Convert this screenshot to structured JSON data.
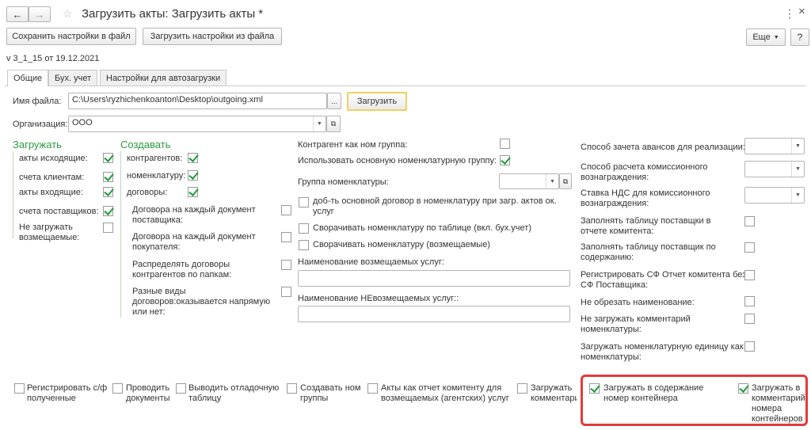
{
  "window": {
    "title": "Загрузить акты: Загрузить акты *"
  },
  "toolbar": {
    "save_settings": "Сохранить настройки в файл",
    "load_settings": "Загрузить настройки из файла",
    "more": "Еще",
    "help": "?"
  },
  "version": "v 3_1_15 от 19.12.2021",
  "tabs": [
    "Общие",
    "Бух. учет",
    "Настройки для автозагрузки"
  ],
  "file": {
    "label": "Имя файла:",
    "value": "C:\\Users\\ryzhichenkoanton\\Desktop\\outgoing.xml",
    "browse": "...",
    "load_button": "Загрузить"
  },
  "org": {
    "label": "Организация:",
    "value": "ООО"
  },
  "load_section": {
    "title": "Загружать",
    "items": [
      {
        "label": "акты исходящие:",
        "checked": true
      },
      {
        "label": "счета клиентам:",
        "checked": true
      },
      {
        "label": "акты входящие:",
        "checked": true
      },
      {
        "label": "счета поставщиков:",
        "checked": true
      },
      {
        "label": "Не загружать возмещаемые:",
        "checked": false
      }
    ]
  },
  "create_section": {
    "title": "Создавать",
    "items": [
      {
        "label": "контрагентов:",
        "checked": true
      },
      {
        "label": "номенклатуру:",
        "checked": true
      },
      {
        "label": "договоры:",
        "checked": true
      },
      {
        "label": "Договора на каждый документ поставщика:",
        "checked": false
      },
      {
        "label": "Договора на каждый документ покупателя:",
        "checked": false
      },
      {
        "label": "Распределять договоры контрагентов по папкам:",
        "checked": false
      },
      {
        "label": "Разные виды договоров:оказывается напрямую или нет:",
        "checked": false
      }
    ]
  },
  "middle": {
    "counterparty_group": {
      "label": "Контрагент как ном группа:",
      "checked": false
    },
    "use_main_group": {
      "label": "Использовать основную номенклатурную группу:",
      "checked": true
    },
    "nom_group": {
      "label": "Группа номенклатуры:"
    },
    "add_main_contract": {
      "label": "доб-ть основной договор в номенклатуру при загр. актов ок. услуг",
      "checked": false
    },
    "collapse_table": {
      "label": "Сворачивать номенклатуру по таблице (вкл. бух.учет)",
      "checked": false
    },
    "collapse_reimb": {
      "label": "Сворачивать номенклатуру (возмещаемые)",
      "checked": false
    },
    "reimb_name": {
      "label": "Наименование возмещаемых услуг:"
    },
    "nonreimb_name": {
      "label": "Наименование НЕвозмещаемых услуг::"
    }
  },
  "right": [
    {
      "label": "Способ зачета авансов для реализации:",
      "type": "select"
    },
    {
      "label": "Способ расчета комиссионного вознаграждения:",
      "type": "select"
    },
    {
      "label": "Ставка НДС для комиссионного вознаграждения:",
      "type": "select"
    },
    {
      "label": "Заполнять таблицу поставщки в отчете комитента:",
      "type": "check",
      "checked": false
    },
    {
      "label": "Заполнять таблицу поставщик по содержанию:",
      "type": "check",
      "checked": false
    },
    {
      "label": "Регистрировать СФ Отчет комитента без СФ Поставщика:",
      "type": "check",
      "checked": false
    },
    {
      "label": "Не обрезать наименование:",
      "type": "check",
      "checked": false
    },
    {
      "label": "Не загружать комментарий номенклатуры:",
      "type": "check",
      "checked": false
    },
    {
      "label": "Загружать номенклатурную единицу как номенклатуры:",
      "type": "check",
      "checked": false
    }
  ],
  "bottom": [
    {
      "label": "Регистрировать с/ф полученные",
      "checked": false
    },
    {
      "label": "Проводить документы",
      "checked": false
    },
    {
      "label": "Выводить отладочную таблицу",
      "checked": false
    },
    {
      "label": "Создавать ном группы",
      "checked": false
    },
    {
      "label": "Акты как отчет комитенту для возмещаемых (агентских) услуг",
      "checked": false
    },
    {
      "label": "Загружать комментарий",
      "checked": false
    },
    {
      "label": "Загружать в содержание номер контейнера",
      "checked": true
    },
    {
      "label": "Загружать в комментарий номера контейнеров",
      "checked": true
    }
  ],
  "colors": {
    "green": "#2a9d3e",
    "highlight": "#e23b3b",
    "focus": "#f0d060"
  }
}
